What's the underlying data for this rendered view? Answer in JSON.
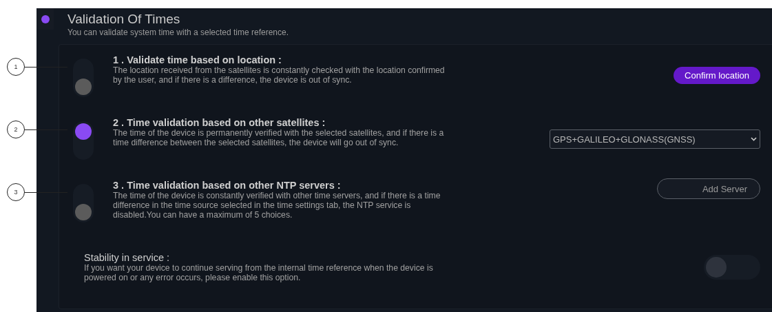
{
  "section": {
    "title": "Validation Of Times",
    "subtitle": "You can validate system time with a selected time reference."
  },
  "options": [
    {
      "callout": "1",
      "title": "1 . Validate time based on location :",
      "description": "The location received from the satellites is constantly checked with the location confirmed by the user, and if there is a difference, the device is out of sync.",
      "on": false,
      "control": {
        "kind": "button",
        "label": "Confirm location"
      }
    },
    {
      "callout": "2",
      "title": "2 . Time validation based on other satellites :",
      "description": "The time of the device is permanently verified with the selected satellites, and if there is a time difference between the selected satellites, the device will go out of sync.",
      "on": true,
      "control": {
        "kind": "select",
        "value": "GPS+GALILEO+GLONASS(GNSS)"
      }
    },
    {
      "callout": "3",
      "title": "3 . Time validation based on other NTP servers :",
      "description": "The time of the device is constantly verified with other time servers, and if there is a time difference in the time source selected in the time settings tab, the NTP service is disabled.You can have a maximum of 5 choices.",
      "on": false,
      "control": {
        "kind": "outline-button",
        "label": "Add Server"
      }
    }
  ],
  "stability": {
    "title": "Stability in service :",
    "description": "If you want your device to continue serving from the internal time reference when the device is powered on or any error occurs, please enable this option.",
    "on": false
  }
}
